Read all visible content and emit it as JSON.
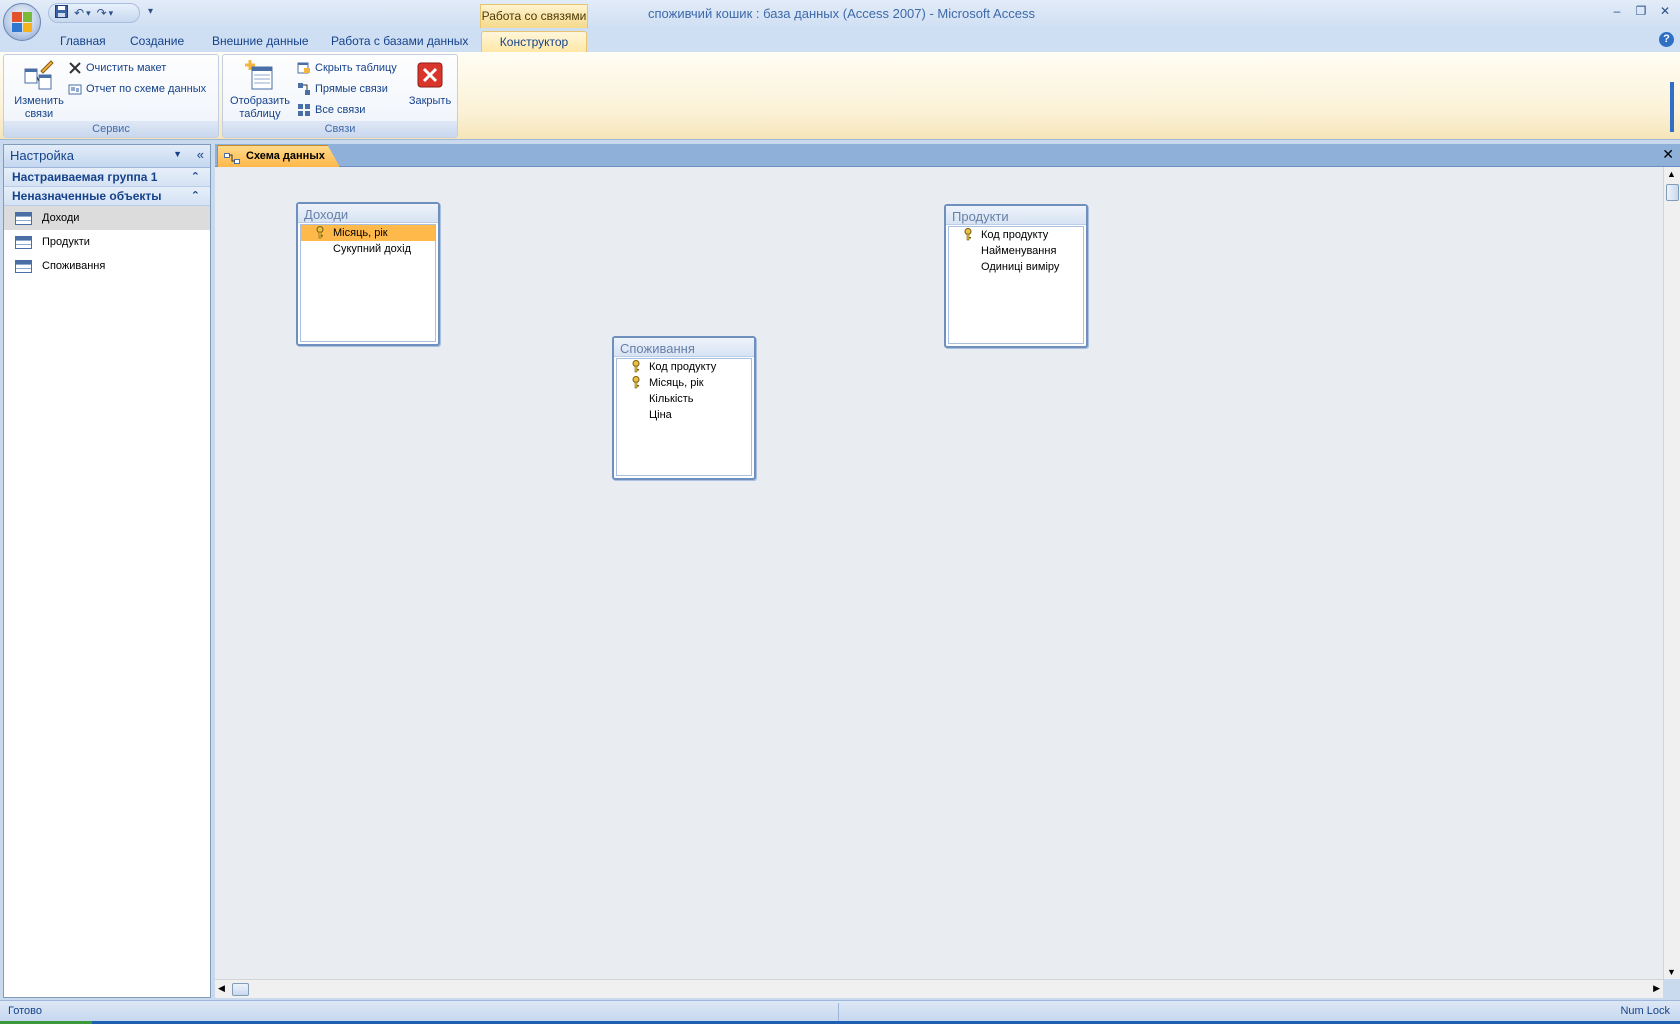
{
  "window": {
    "title": "споживчий кошик : база данных (Access 2007)",
    "app_name": "Microsoft Access",
    "context_tab_group": "Работа со связями",
    "minimize_icon": "minimize-icon",
    "restore_icon": "restore-icon",
    "close_icon": "close-icon"
  },
  "ribbon": {
    "tabs": [
      {
        "label": "Главная"
      },
      {
        "label": "Создание"
      },
      {
        "label": "Внешние данные"
      },
      {
        "label": "Работа с базами данных"
      },
      {
        "label": "Конструктор",
        "active": true
      }
    ],
    "groups": {
      "service": {
        "label": "Сервис",
        "edit_relationships": "Изменить связи",
        "clear_layout": "Очистить макет",
        "relationship_report": "Отчет по схеме данных"
      },
      "relationships": {
        "label": "Связи",
        "show_table": "Отобразить таблицу",
        "hide_table": "Скрыть таблицу",
        "direct_relationships": "Прямые связи",
        "all_relationships": "Все связи",
        "close": "Закрыть"
      }
    }
  },
  "nav": {
    "title": "Настройка",
    "groups": [
      {
        "label": "Настраиваемая группа 1"
      },
      {
        "label": "Неназначенные объекты"
      }
    ],
    "items": [
      {
        "label": "Доходи",
        "selected": true
      },
      {
        "label": "Продукти"
      },
      {
        "label": "Споживання"
      }
    ]
  },
  "document": {
    "tab_label": "Схема данных"
  },
  "tables": [
    {
      "title": "Доходи",
      "fields": [
        {
          "name": "Місяць, рік",
          "key": true,
          "selected": true
        },
        {
          "name": "Сукупний дохід",
          "key": false
        }
      ]
    },
    {
      "title": "Споживання",
      "fields": [
        {
          "name": "Код продукту",
          "key": true
        },
        {
          "name": "Місяць, рік",
          "key": true
        },
        {
          "name": "Кількість",
          "key": false
        },
        {
          "name": "Ціна",
          "key": false
        }
      ]
    },
    {
      "title": "Продукти",
      "fields": [
        {
          "name": "Код продукту",
          "key": true
        },
        {
          "name": "Найменування",
          "key": false
        },
        {
          "name": "Одиниці виміру",
          "key": false
        }
      ]
    }
  ],
  "status": {
    "left": "Готово",
    "right": "Num Lock"
  },
  "colors": {
    "accent": "#15428b",
    "selection": "#ffb84a",
    "canvas": "#e9edf1"
  }
}
